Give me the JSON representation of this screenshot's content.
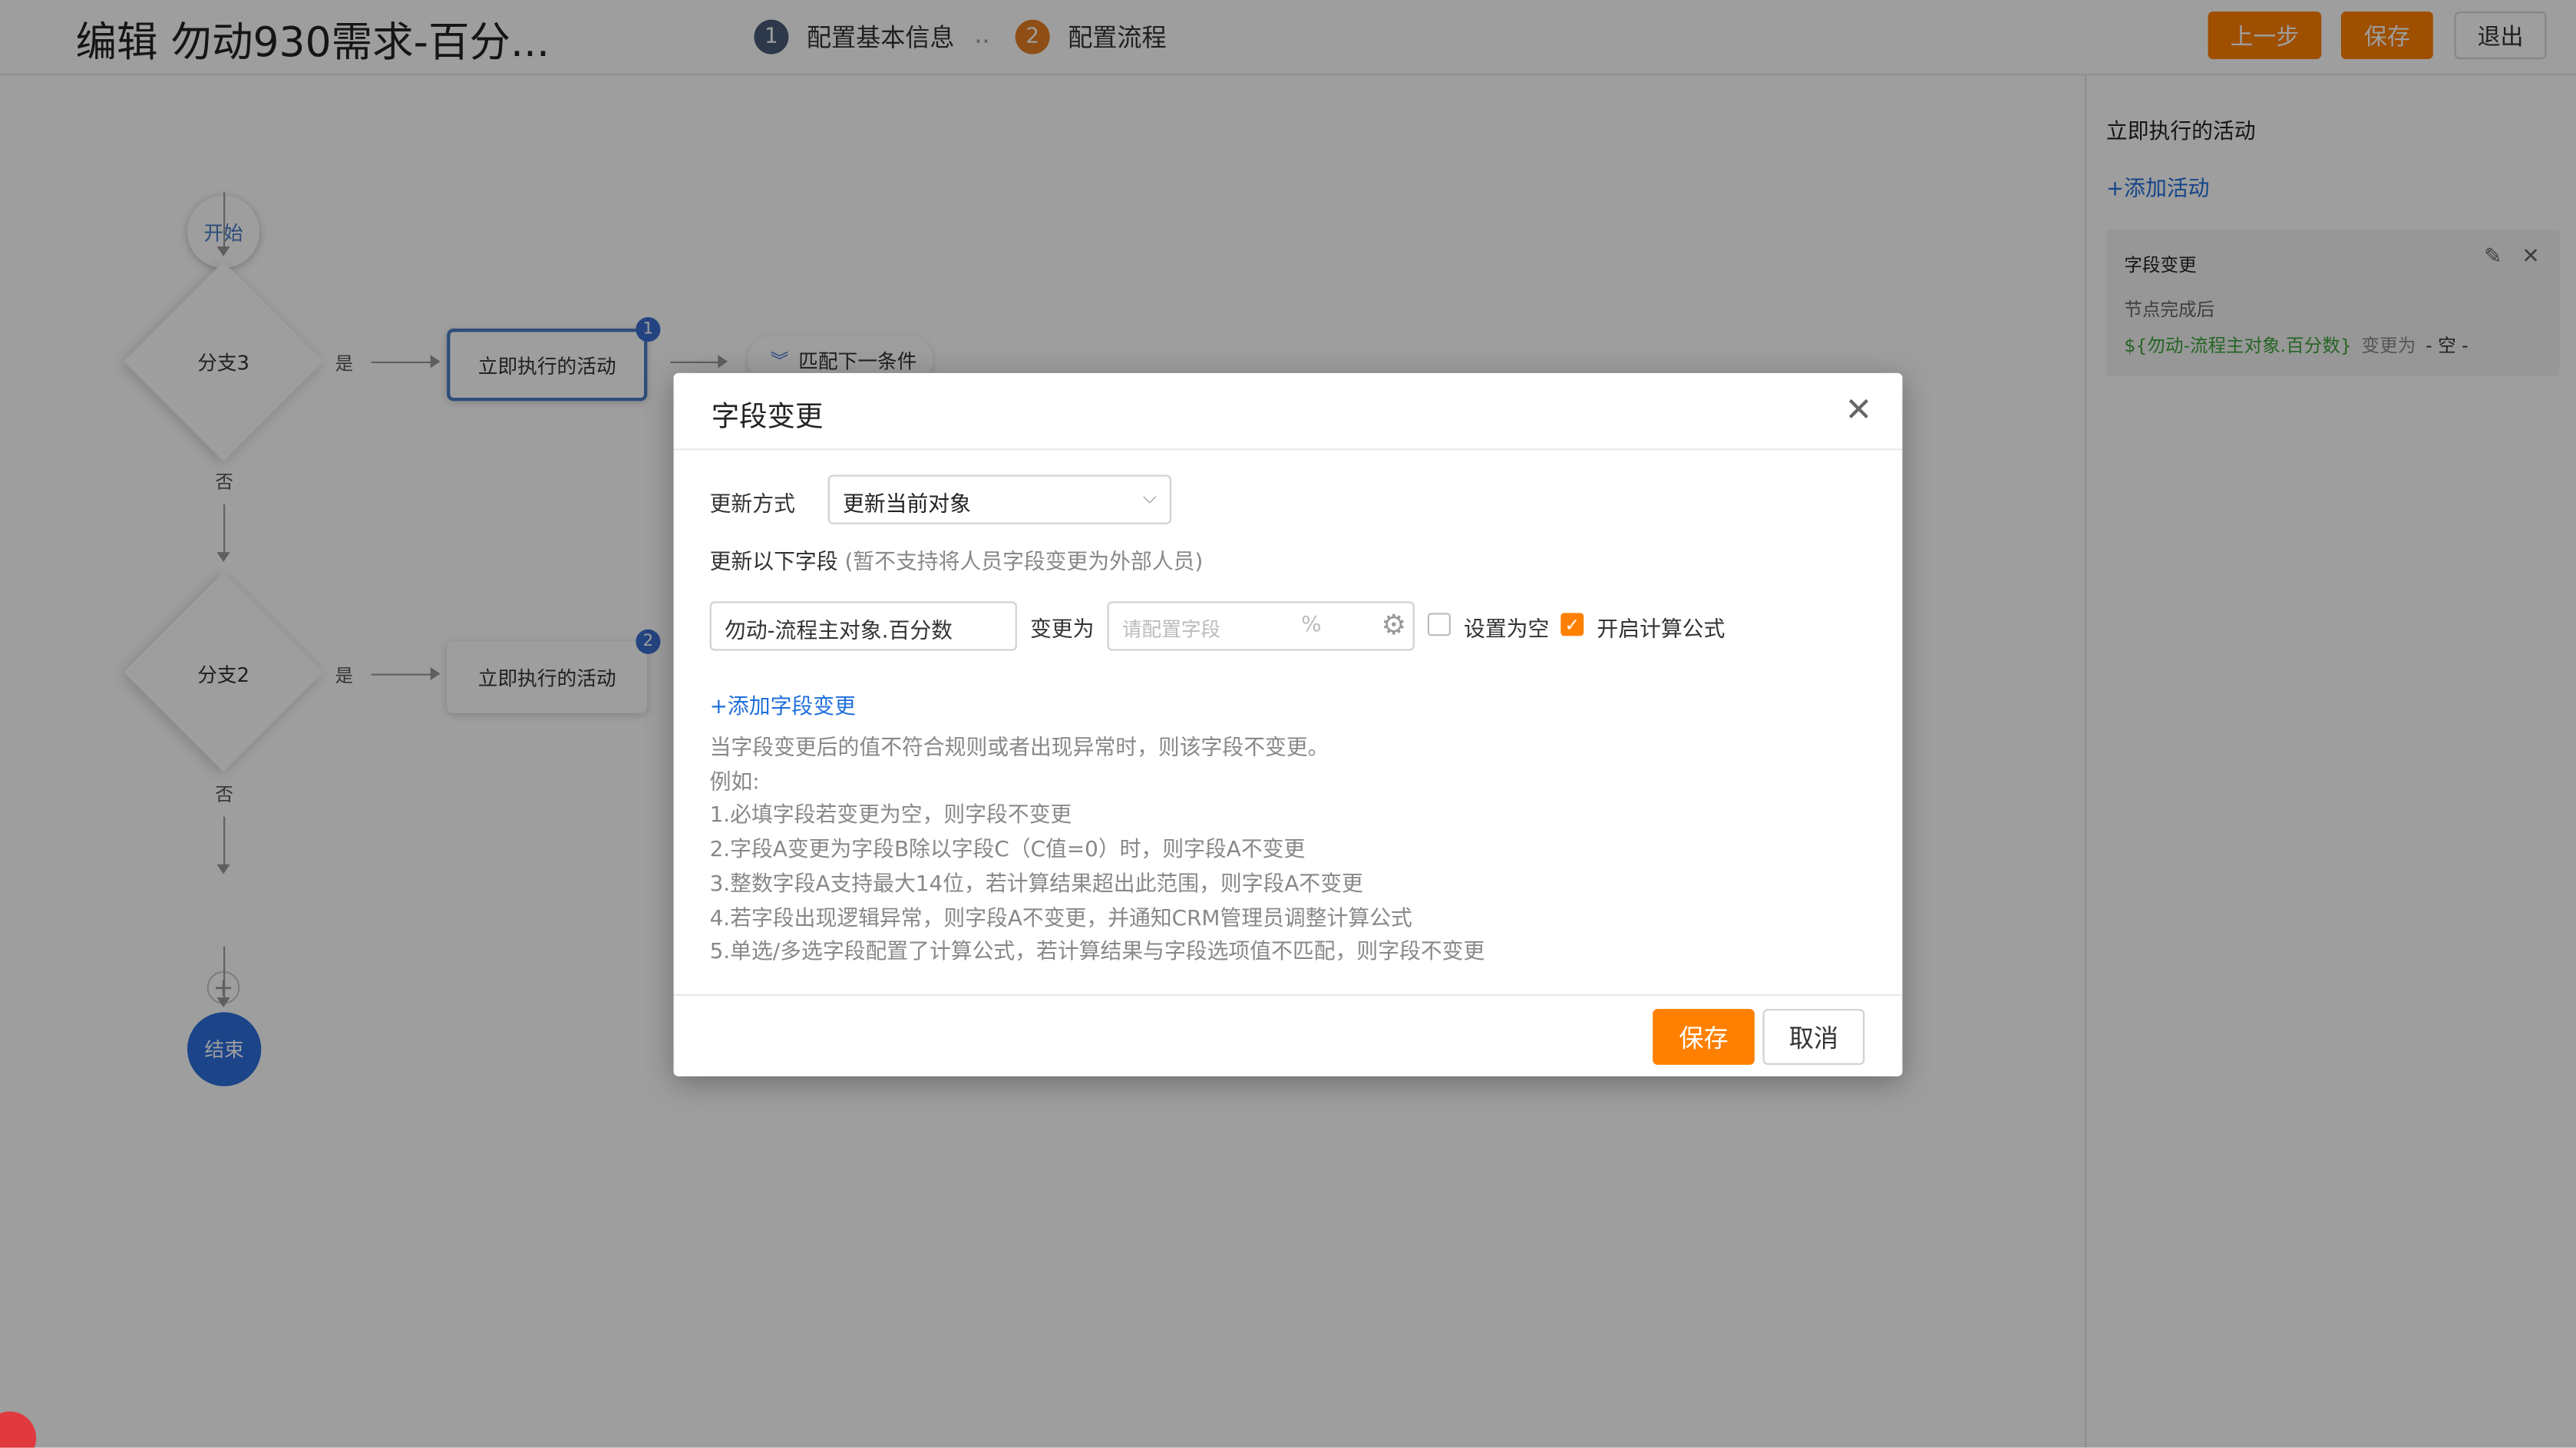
{
  "header": {
    "title": "编辑 勿动930需求-百分...",
    "steps": [
      {
        "num": "1",
        "label": "配置基本信息"
      },
      {
        "num": "2",
        "label": "配置流程"
      }
    ],
    "step_separator": "..",
    "buttons": {
      "prev": "上一步",
      "save": "保存",
      "exit": "退出"
    }
  },
  "flow": {
    "start": "开始",
    "end": "结束",
    "add": "+",
    "branches": [
      {
        "label": "分支3",
        "yes": "是",
        "no": "否",
        "activity": "立即执行的活动",
        "badge": "1"
      },
      {
        "label": "分支2",
        "yes": "是",
        "no": "否",
        "activity": "立即执行的活动",
        "badge": "2"
      }
    ],
    "match_next": "匹配下一条件"
  },
  "right_panel": {
    "title": "立即执行的活动",
    "add_activity": "+添加活动",
    "card": {
      "title": "字段变更",
      "subtitle": "节点完成后",
      "field": "${勿动-流程主对象.百分数}",
      "change_to": "变更为",
      "value": "- 空 -"
    }
  },
  "modal": {
    "title": "字段变更",
    "update_mode_label": "更新方式",
    "update_mode_value": "更新当前对象",
    "update_fields_label": "更新以下字段",
    "update_fields_hint": "(暂不支持将人员字段变更为外部人员)",
    "field_value": "勿动-流程主对象.百分数",
    "change_to": "变更为",
    "formula_placeholder": "请配置字段",
    "percent": "%",
    "set_empty_label": "设置为空",
    "set_empty_checked": false,
    "enable_formula_label": "开启计算公式",
    "enable_formula_checked": true,
    "add_field_link": "+添加字段变更",
    "notes": [
      "当字段变更后的值不符合规则或者出现异常时，则该字段不变更。",
      "例如:",
      "1.必填字段若变更为空，则字段不变更",
      "2.字段A变更为字段B除以字段C（C值=0）时，则字段A不变更",
      "3.整数字段A支持最大14位，若计算结果超出此范围，则字段A不变更",
      "4.若字段出现逻辑异常，则字段A不变更，并通知CRM管理员调整计算公式",
      "5.单选/多选字段配置了计算公式，若计算结果与字段选项值不匹配，则字段不变更"
    ],
    "buttons": {
      "save": "保存",
      "cancel": "取消"
    }
  },
  "icons": {
    "close": "close-icon",
    "edit": "pencil-icon",
    "gear": "gear-icon",
    "chevron": "chevron-down-icon",
    "double_chevron": "double-chevron-down-icon",
    "check": "check-icon"
  },
  "colors": {
    "accent": "#ff8000",
    "link": "#1f6fdb",
    "node_blue": "#2d6fdd",
    "badge_blue": "#3b6fd0",
    "step1": "#4a5b78",
    "step2": "#e67e22",
    "field_green": "#3da33d"
  }
}
